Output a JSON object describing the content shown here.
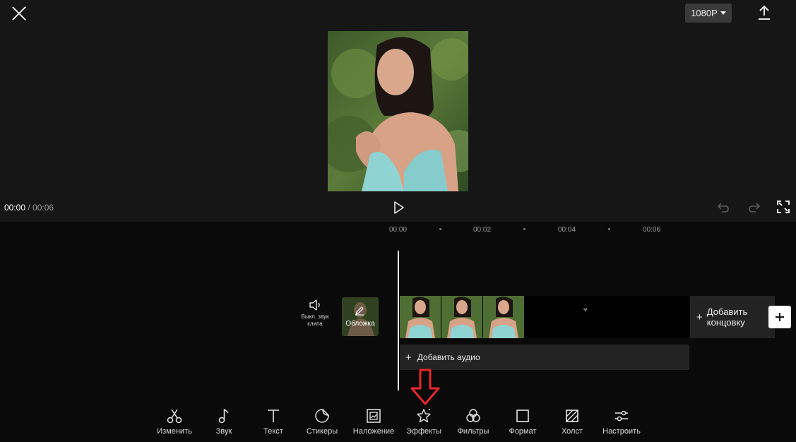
{
  "header": {
    "close_icon": "close-icon",
    "resolution": "1080P",
    "export_icon": "upload-icon"
  },
  "player": {
    "current_time": "00:00",
    "separator": " / ",
    "total_time": "00:06",
    "controls": [
      "play-icon",
      "undo-icon",
      "redo-icon",
      "fullscreen-icon"
    ]
  },
  "ruler": {
    "labels": [
      "00:00",
      "00:02",
      "00:04",
      "00:06"
    ]
  },
  "track": {
    "mute_label_line1": "Выкл. звук",
    "mute_label_line2": "клипа",
    "cover_label": "Обложка",
    "transition_mark": "⩝",
    "add_ending_line1": "Добавить",
    "add_ending_line2": "концовку",
    "add_audio": "Добавить аудио",
    "plus": "+"
  },
  "toolbar": {
    "items": [
      {
        "label": "Изменить",
        "icon": "scissors-icon"
      },
      {
        "label": "Звук",
        "icon": "music-note-icon"
      },
      {
        "label": "Текст",
        "icon": "text-icon"
      },
      {
        "label": "Стикеры",
        "icon": "sticker-icon"
      },
      {
        "label": "Наложение",
        "icon": "overlay-icon"
      },
      {
        "label": "Эффекты",
        "icon": "effects-star-icon"
      },
      {
        "label": "Фильтры",
        "icon": "filters-icon"
      },
      {
        "label": "Формат",
        "icon": "format-square-icon"
      },
      {
        "label": "Холст",
        "icon": "canvas-icon"
      },
      {
        "label": "Настроить",
        "icon": "adjust-sliders-icon"
      }
    ]
  },
  "colors": {
    "background": "#000000",
    "preview_bg": "#161616",
    "panel": "#232323",
    "accent_arrow": "#e8262b"
  }
}
